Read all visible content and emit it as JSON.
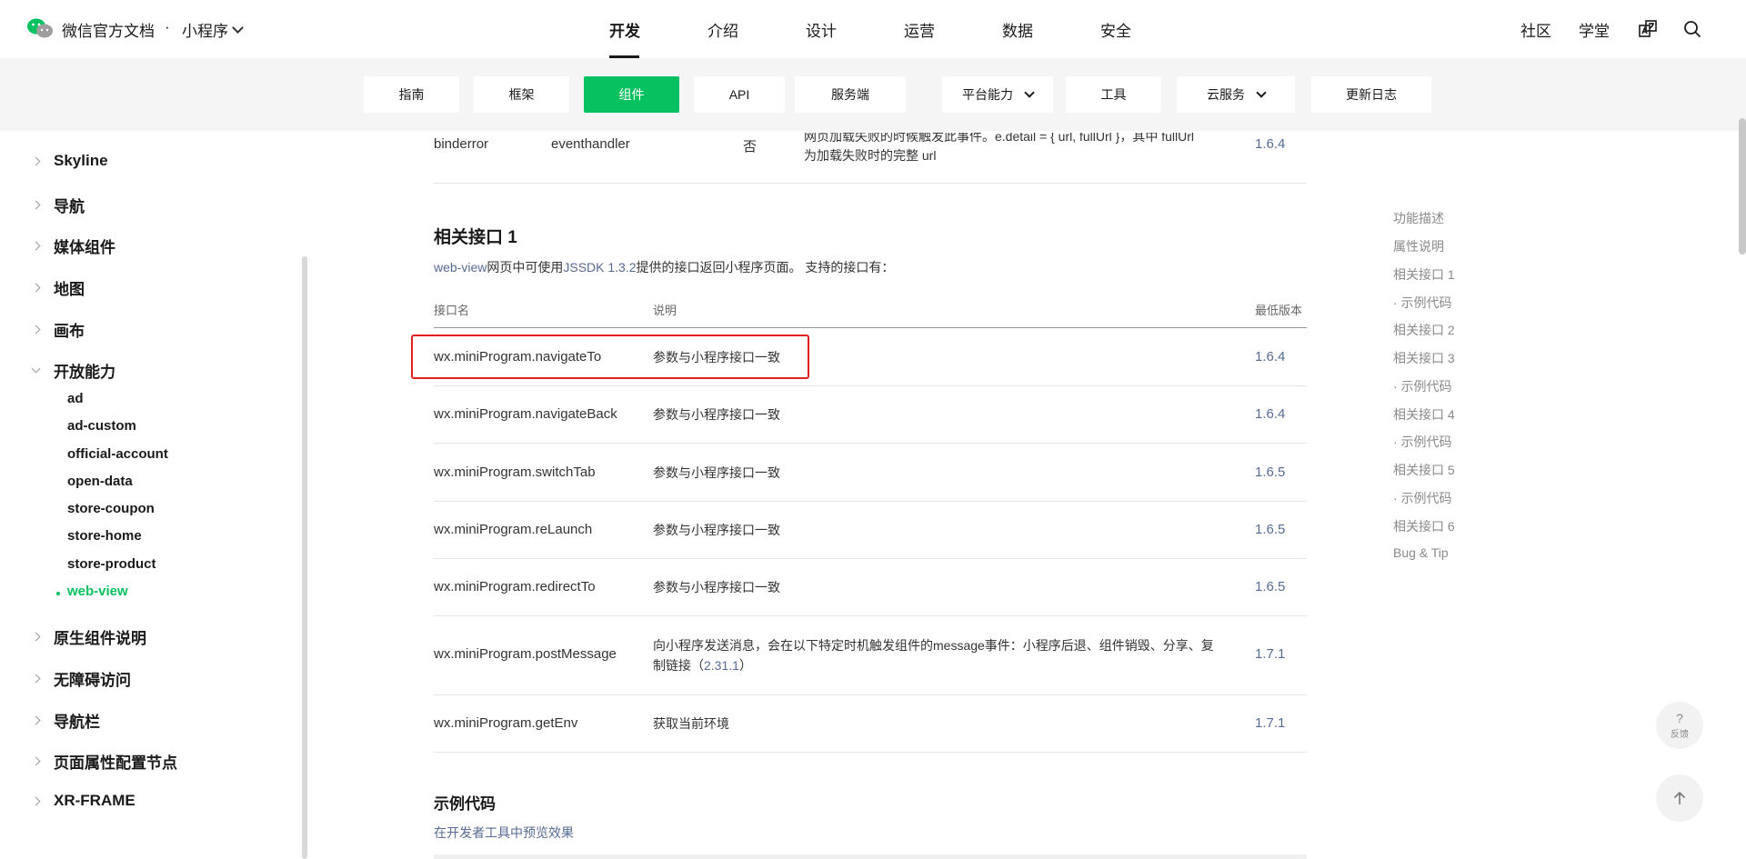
{
  "header": {
    "brand": "微信官方文档",
    "dot": "·",
    "product": "小程序",
    "tabs": [
      "开发",
      "介绍",
      "设计",
      "运营",
      "数据",
      "安全"
    ],
    "right_links": [
      "社区",
      "学堂"
    ]
  },
  "subnav": {
    "items": [
      "指南",
      "框架",
      "组件",
      "API",
      "服务端",
      "平台能力",
      "工具",
      "云服务",
      "更新日志"
    ]
  },
  "sidebar": {
    "groups": [
      "Skyline",
      "导航",
      "媒体组件",
      "地图",
      "画布",
      "开放能力",
      "原生组件说明",
      "无障碍访问",
      "导航栏",
      "页面属性配置节点",
      "XR-FRAME"
    ],
    "sub_items": [
      "ad",
      "ad-custom",
      "official-account",
      "open-data",
      "store-coupon",
      "store-home",
      "store-product",
      "web-view"
    ]
  },
  "content": {
    "top_row": {
      "name": "binderror",
      "type": "eventhandler",
      "required": "否",
      "desc_line1": "网页加载失败的时候触发此事件。e.detail = { url, fullUrl }，其中 fullUrl",
      "desc_line2": "为加载失败时的完整 url",
      "version": "1.6.4"
    },
    "section1_title": "相关接口 1",
    "intro": {
      "link1": "web-view",
      "text1": "网页中可使用",
      "link2": "JSSDK 1.3.2",
      "text2": "提供的接口返回小程序页面。 支持的接口有："
    },
    "table_headers": [
      "接口名",
      "说明",
      "最低版本"
    ],
    "rows": [
      {
        "name": "wx.miniProgram.navigateTo",
        "desc": "参数与小程序接口一致",
        "version": "1.6.4"
      },
      {
        "name": "wx.miniProgram.navigateBack",
        "desc": "参数与小程序接口一致",
        "version": "1.6.4"
      },
      {
        "name": "wx.miniProgram.switchTab",
        "desc": "参数与小程序接口一致",
        "version": "1.6.5"
      },
      {
        "name": "wx.miniProgram.reLaunch",
        "desc": "参数与小程序接口一致",
        "version": "1.6.5"
      },
      {
        "name": "wx.miniProgram.redirectTo",
        "desc": "参数与小程序接口一致",
        "version": "1.6.5"
      },
      {
        "name": "wx.miniProgram.postMessage",
        "desc_line1": "向小程序发送消息，会在以下特定时机触发组件的message事件：小程序后退、组件销毁、分享、复",
        "desc_line2_text": "制链接（",
        "desc_line2_link": "2.31.1",
        "desc_line2_end": "）",
        "version": "1.7.1"
      },
      {
        "name": "wx.miniProgram.getEnv",
        "desc": "获取当前环境",
        "version": "1.7.1"
      }
    ],
    "section2_title": "示例代码",
    "preview_link": "在开发者工具中预览效果"
  },
  "toc": [
    "功能描述",
    "属性说明",
    "相关接口 1",
    "· 示例代码",
    "相关接口 2",
    "相关接口 3",
    "· 示例代码",
    "相关接口 4",
    "· 示例代码",
    "相关接口 5",
    "· 示例代码",
    "相关接口 6",
    "Bug & Tip"
  ],
  "float": {
    "feedback_symbol": "?",
    "feedback_label": "反馈"
  },
  "colors": {
    "accent": "#07c160",
    "link": "#576b95",
    "highlight": "#e02020"
  }
}
